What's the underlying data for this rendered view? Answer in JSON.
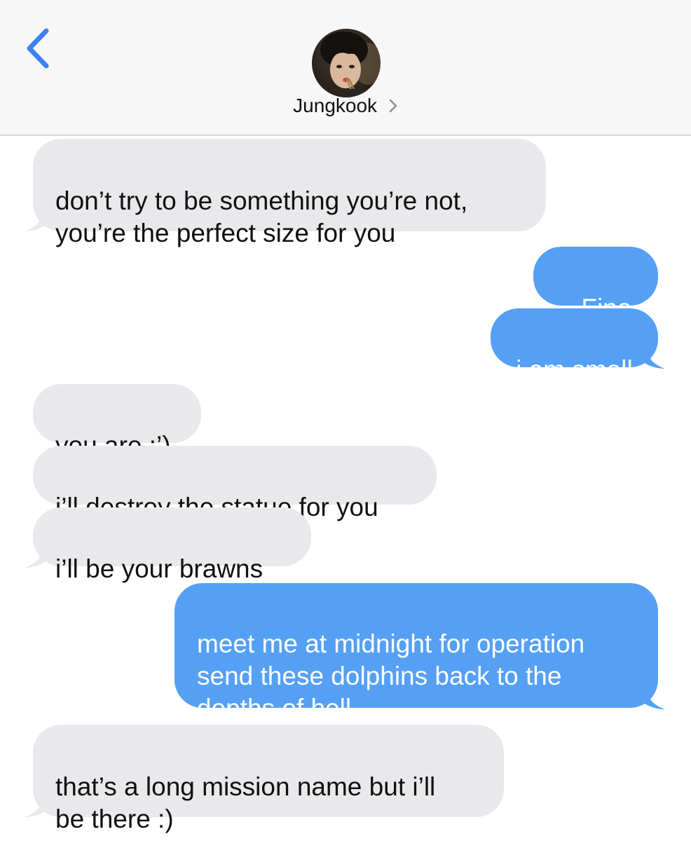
{
  "header": {
    "contact_name": "Jungkook",
    "back_icon": "chevron-left-icon",
    "detail_icon": "chevron-right-icon",
    "accent_color": "#3b82f6"
  },
  "colors": {
    "received_bubble": "#e9e9eb",
    "sent_bubble": "#55a0f5"
  },
  "messages": [
    {
      "from": "contact",
      "text": "don’t try to be something you’re not,\nyou’re the perfect size for you"
    },
    {
      "from": "me",
      "text": ".. Fine"
    },
    {
      "from": "me",
      "text": "i am small"
    },
    {
      "from": "contact",
      "text": "you are :’)"
    },
    {
      "from": "contact",
      "text": "i’ll destroy the statue for you"
    },
    {
      "from": "contact",
      "text": "i’ll be your brawns"
    },
    {
      "from": "me",
      "text": "meet me at midnight for operation\nsend these dolphins back to the\ndepths of hell"
    },
    {
      "from": "contact",
      "text": "that’s a long mission name but i’ll\nbe there :)"
    }
  ]
}
